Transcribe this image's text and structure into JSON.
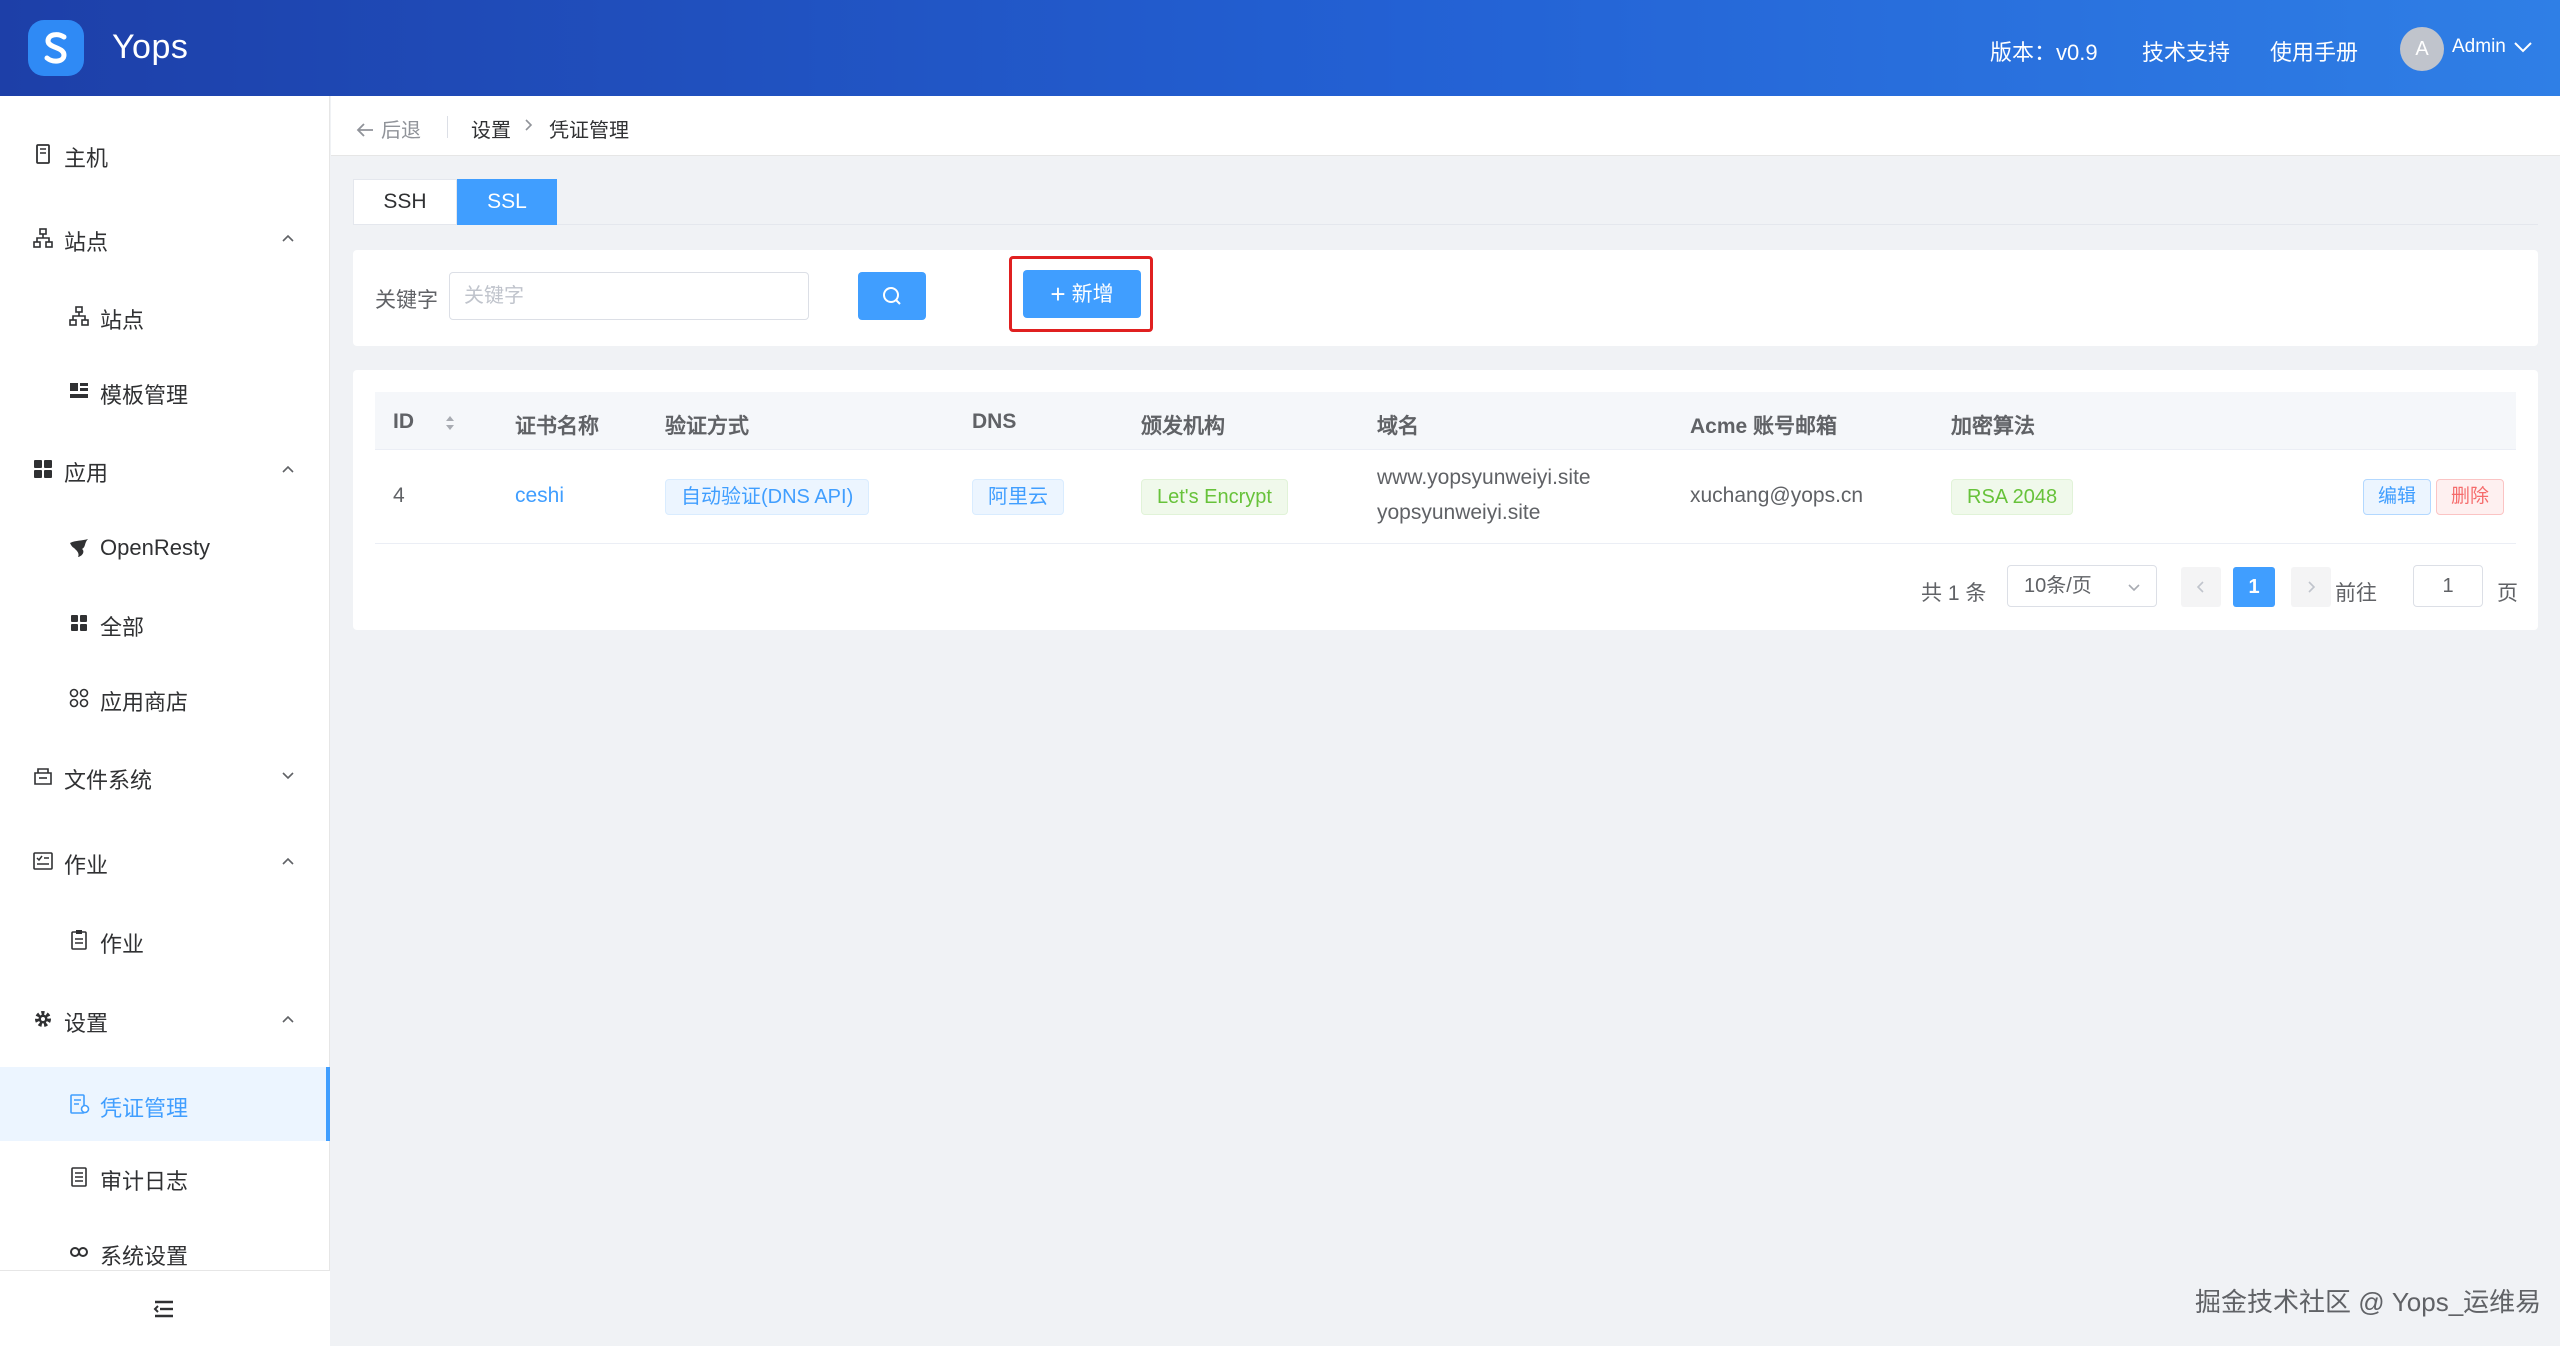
{
  "header": {
    "app_name": "Yops",
    "version": "版本：v0.9",
    "support": "技术支持",
    "manual": "使用手册",
    "avatar_letter": "A",
    "user": "Admin"
  },
  "sidebar": {
    "items": [
      {
        "label": "主机",
        "icon": "host-icon"
      },
      {
        "label": "站点",
        "icon": "sitemap-icon"
      },
      {
        "label": "站点",
        "icon": "sitemap-icon"
      },
      {
        "label": "模板管理",
        "icon": "template-icon"
      },
      {
        "label": "应用",
        "icon": "grid-icon"
      },
      {
        "label": "OpenResty",
        "icon": "openresty-icon"
      },
      {
        "label": "全部",
        "icon": "grid-icon"
      },
      {
        "label": "应用商店",
        "icon": "store-icon"
      },
      {
        "label": "文件系统",
        "icon": "filesystem-icon"
      },
      {
        "label": "作业",
        "icon": "job-icon"
      },
      {
        "label": "作业",
        "icon": "clipboard-icon"
      },
      {
        "label": "设置",
        "icon": "gear-icon"
      },
      {
        "label": "凭证管理",
        "icon": "credential-icon"
      },
      {
        "label": "审计日志",
        "icon": "log-icon"
      },
      {
        "label": "系统设置",
        "icon": "link-icon"
      }
    ]
  },
  "breadcrumb": {
    "back": "后退",
    "items": [
      "设置",
      "凭证管理"
    ]
  },
  "tabs": [
    "SSH",
    "SSL"
  ],
  "active_tab": "SSL",
  "search": {
    "label": "关键字",
    "placeholder": "关键字",
    "value": ""
  },
  "add_button": "新增",
  "table": {
    "columns": [
      "ID",
      "证书名称",
      "验证方式",
      "DNS",
      "颁发机构",
      "域名",
      "Acme 账号邮箱",
      "加密算法"
    ],
    "rows": [
      {
        "id": "4",
        "name": "ceshi",
        "verify": "自动验证(DNS API)",
        "dns": "阿里云",
        "issuer": "Let's Encrypt",
        "domains": [
          "www.yopsyunweiyi.site",
          "yopsyunweiyi.site"
        ],
        "email": "xuchang@yops.cn",
        "algo": "RSA 2048",
        "edit": "编辑",
        "delete": "删除"
      }
    ]
  },
  "pagination": {
    "total": "共 1 条",
    "page_size": "10条/页",
    "current": "1",
    "goto_label": "前往",
    "goto_value": "1",
    "page_suffix": "页"
  },
  "watermark": "掘金技术社区 @ Yops_运维易",
  "colors": {
    "primary": "#409eff",
    "header_start": "#1d3fa8",
    "header_end": "#2f7fe6",
    "danger": "#f56c6c",
    "success": "#67c23a",
    "highlight": "#e02020"
  }
}
